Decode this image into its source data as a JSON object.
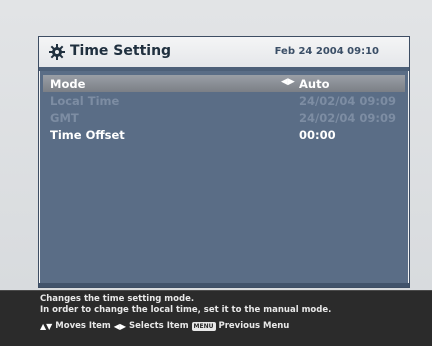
{
  "header": {
    "title": "Time Setting",
    "datetime": "Feb 24 2004 09:10",
    "icon": "gear-icon"
  },
  "settings": [
    {
      "label": "Mode",
      "value": "Auto",
      "state": "selected"
    },
    {
      "label": "Local Time",
      "value": "24/02/04 09:09",
      "state": "disabled"
    },
    {
      "label": "GMT",
      "value": "24/02/04 09:09",
      "state": "disabled"
    },
    {
      "label": "Time Offset",
      "value": "00:00",
      "state": "normal"
    }
  ],
  "help": {
    "line1": "Changes the time setting mode.",
    "line2": "In order to change the local time, set it to the manual mode."
  },
  "hints": {
    "moves_label": "Moves Item",
    "selects_label": "Selects Item",
    "menu_key": "MENU",
    "previous_label": "Previous Menu"
  },
  "colors": {
    "panel": "#5a6d86",
    "selected_row": "#8a8f96",
    "disabled_text": "#7d8da3",
    "footer": "#2b2b2b"
  }
}
